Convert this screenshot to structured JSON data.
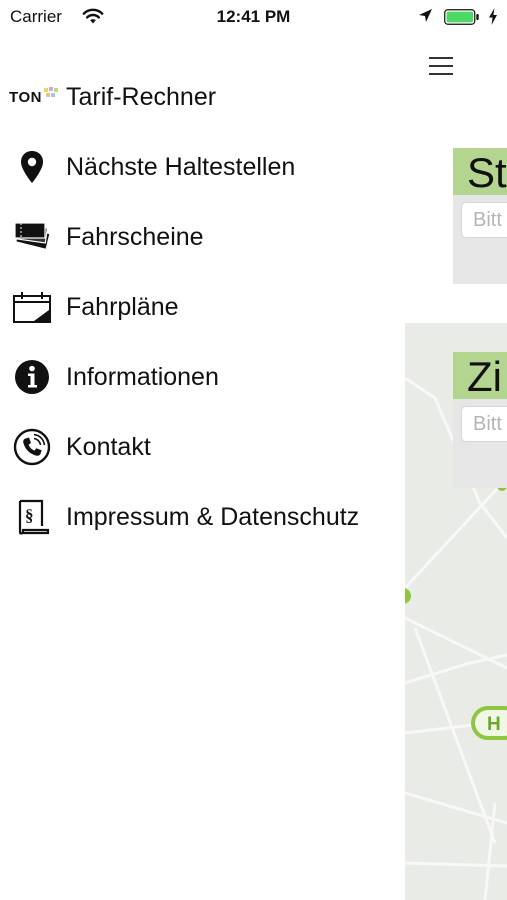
{
  "status_bar": {
    "carrier": "Carrier",
    "time": "12:41 PM",
    "battery_color": "#4cd964"
  },
  "drawer": {
    "items": [
      {
        "label": "Tarif-Rechner",
        "icon": "ton-logo-icon",
        "logo_text": "TON"
      },
      {
        "label": "Nächste Haltestellen",
        "icon": "map-pin-icon"
      },
      {
        "label": "Fahrscheine",
        "icon": "tickets-icon"
      },
      {
        "label": "Fahrpläne",
        "icon": "calendar-icon"
      },
      {
        "label": "Informationen",
        "icon": "info-icon"
      },
      {
        "label": "Kontakt",
        "icon": "phone-icon"
      },
      {
        "label": "Impressum & Datenschutz",
        "icon": "paragraph-document-icon"
      }
    ]
  },
  "main": {
    "start_card": {
      "title": "St",
      "placeholder": "Bitt"
    },
    "destination_card": {
      "title": "Zi",
      "placeholder": "Bitt"
    },
    "accent_color": "#b3d58f",
    "map_stop_color": "#8dc63f"
  }
}
